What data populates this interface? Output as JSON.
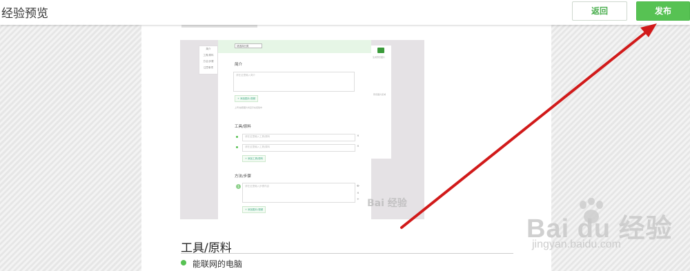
{
  "header": {
    "title": "经验预览",
    "back_label": "返回",
    "publish_label": "发布"
  },
  "screenshot": {
    "left_nav": [
      "简介",
      "工具/原料",
      "方法/步骤",
      "注意事项"
    ],
    "category_select": "请选择分类",
    "intro_heading": "简介",
    "intro_placeholder": "请在这里输入简介",
    "add_image_button": "+ 添加图片/视频",
    "intro_tip": "上传/拍照图片将显示在经验中",
    "tools_heading": "工具/原料",
    "tool_placeholders": [
      "请在这里输入工具/原料",
      "请在这里输入工具/原料"
    ],
    "add_tool_button": "+ 添加工具/原料",
    "steps_heading": "方法/步骤",
    "step_number": "1",
    "step_placeholder": "请在这里输入步骤内容",
    "add_step_image_button": "+ 添加图片/视频",
    "right_panel_label": "生成预览图片",
    "right_panel_hint": "预览图片区域",
    "watermark": "Bai 经验"
  },
  "content": {
    "section_title": "工具/原料",
    "items": [
      "能联网的电脑"
    ]
  },
  "watermark": {
    "word": "Bai du 经验",
    "url": "jingyan.baidu.com"
  },
  "colors": {
    "accent_green": "#57c253",
    "arrow_red": "#d11a1a"
  }
}
